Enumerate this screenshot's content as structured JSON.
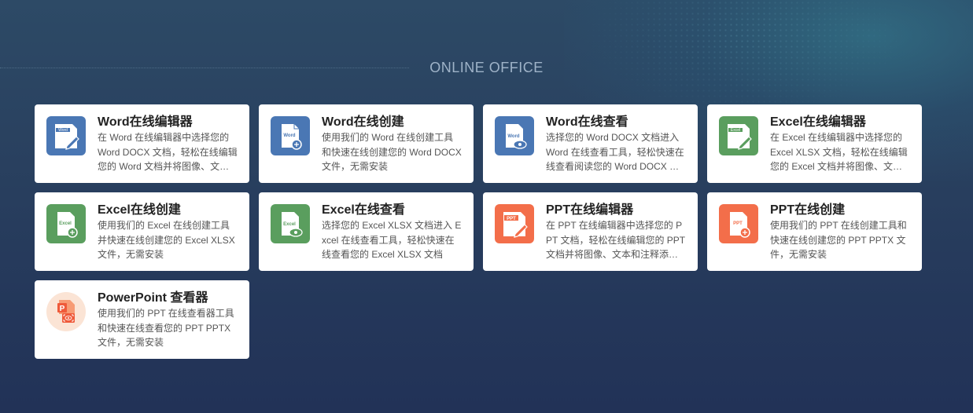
{
  "section": {
    "title": "ONLINE OFFICE"
  },
  "colors": {
    "word": "#4a77b4",
    "excel": "#5a9e5e",
    "ppt": "#f36e4a",
    "powerpoint_bg": "#fbe4d5"
  },
  "cards": [
    {
      "icon": "word-edit-icon",
      "icon_label": "Word",
      "title": "Word在线编辑器",
      "desc": "在 Word 在线编辑器中选择您的 Word DOCX 文档，轻松在线编辑您的 Word 文档并将图像、文本和注释添加到文档中"
    },
    {
      "icon": "word-create-icon",
      "icon_label": "Word",
      "title": "Word在线创建",
      "desc": "使用我们的 Word 在线创建工具和快速在线创建您的 Word DOCX 文件，无需安装"
    },
    {
      "icon": "word-view-icon",
      "icon_label": "Word",
      "title": "Word在线查看",
      "desc": "选择您的 Word DOCX 文档进入 Word 在线查看工具，轻松快速在线查看阅读您的 Word DOCX 文档"
    },
    {
      "icon": "excel-edit-icon",
      "icon_label": "Excel",
      "title": "Excel在线编辑器",
      "desc": "在 Excel 在线编辑器中选择您的 Excel XLSX 文档，轻松在线编辑您的 Excel 文档并将图像、文本和注释添加到文档中"
    },
    {
      "icon": "excel-create-icon",
      "icon_label": "Excel",
      "title": "Excel在线创建",
      "desc": "使用我们的 Excel 在线创建工具并快速在线创建您的 Excel XLSX 文件，无需安装"
    },
    {
      "icon": "excel-view-icon",
      "icon_label": "Excel",
      "title": "Excel在线查看",
      "desc": "选择您的 Excel XLSX 文档进入 Excel 在线查看工具，轻松快速在线查看您的 Excel XLSX 文档"
    },
    {
      "icon": "ppt-edit-icon",
      "icon_label": "PPT",
      "title": "PPT在线编辑器",
      "desc": "在 PPT 在线编辑器中选择您的 PPT 文档，轻松在线编辑您的 PPT 文档并将图像、文本和注释添加到文档中"
    },
    {
      "icon": "ppt-create-icon",
      "icon_label": "PPT",
      "title": "PPT在线创建",
      "desc": "使用我们的 PPT 在线创建工具和快速在线创建您的 PPT PPTX 文件，无需安装"
    },
    {
      "icon": "powerpoint-view-icon",
      "icon_label": "P",
      "title": "PowerPoint 查看器",
      "desc": "使用我们的 PPT 在线查看器工具和快速在线查看您的 PPT PPTX 文件，无需安装"
    }
  ]
}
